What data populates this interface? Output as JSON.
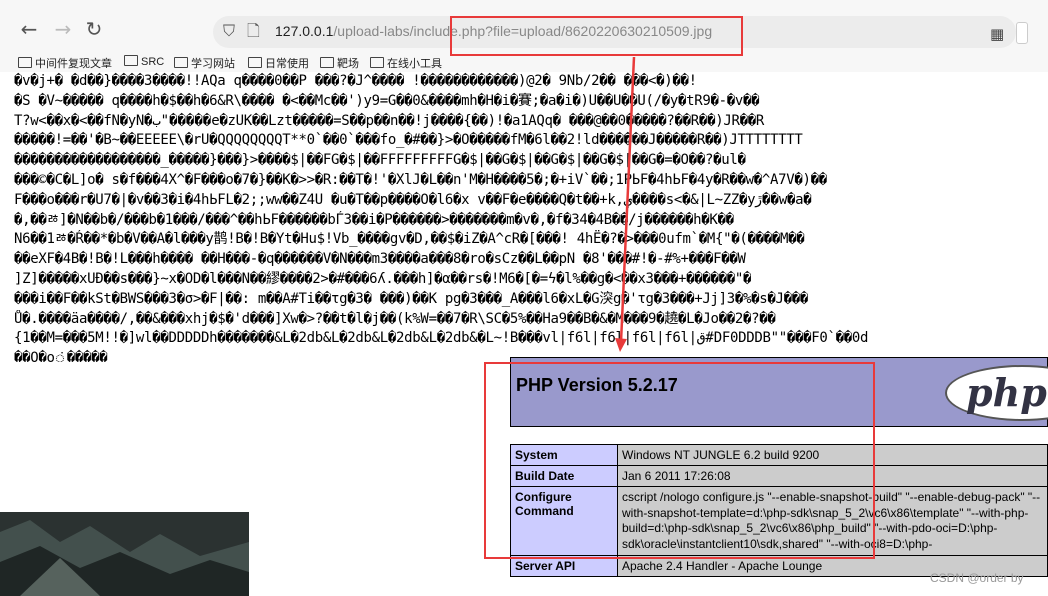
{
  "toolbar": {
    "back_icon": "back-arrow-icon",
    "forward_icon": "forward-arrow-icon",
    "reload_icon": "reload-icon",
    "url_host": "127.0.0.1",
    "url_path": "/upload-labs/include.php?file=upload/8620220630210509.jpg"
  },
  "bookmarks": [
    "中间件复现文章",
    "SRC",
    "学习网站",
    "日常使用",
    "靶场",
    "在线小工具"
  ],
  "garbage_lines": [
    "�v�j+� �d��}����3����!!AQa q����0��P ���?�J^���� !������������)@2� 9Nb/2�� ���<�)��!",
    "�S �V~����� q����h�$��h�6&R\\���� �<��Mc��')y9=G��0&����mh�H�i�賽;�a�i�)U��U��U(/�y�tR9�-�v��",
    "T?w<��x�<��fN�yN�ب\"�����e�zUK��Lzt�����=S��p��n��!j����{��)!�a1AQq� ���@��0�����?��R��)JR��R",
    "�����!=��'�B~��EEEEE\\�rU�QQQQQQQQT**0`��0`���fo_�#��}>�O�����fM�6l��2!ld������J�����R��)JTTTTTTTT",
    "������������������_�����}���}>����$|��FG�$|��FFFFFFFFFG�$|��G�$|��G�$|��G�$|��G�=�O��?�ul�",
    "���©�C�L]o� s�f���4X^�F���o�7�}��K�>>�R:��T�!'�XlJ�L��n'M�H����5�;�+iV`��;1PЬF�4hЬF�4y�R��w�^A7V�)��",
    "F���o���r�U7�|�v��3�i�4hЬFL�2;;ww��Z4U �u�T��p����O�l6�x v��F�e����Q�t��+k,ي����s<�&|L~ZZ�yڙ��w�a�",
    "�,��ﾰ]�N��b�/���b�1���/���^��hЬF������bЃ3��i�P������>�������m�v�,�f�34�4B��/j������h�K��",
    "N6��1ﾰ�Ŕ��*�b�V��A�l���y鹊!B�!B�Yt�Hu$!Vb_����gv�D,��$�iZ�A^cR�[���! 4hË�?�>���0ufm`�M{\"�(����M��",
    "��eXF�4B�!B�!L���h���� ��H���-�q������V�N���m3����a���8�ro�sCz��L��pN �8'���#!�-#%+���F��W",
    "]Z]�����xUĐ��s���}~x�OD�l���N��繆����2>�#���6ʎ.���h]�α��rs�!M6�[�=ϟ�l%��g�<��x3���+������\"�",
    "���i��F��kSt�BWS���3�σ>�F|��: m��A#Ti��τg�3� ���)��K pg�3���_A���l6�xL�G湥g�'τg�3���+Jj]3�%�s�J���",
    "Ů�.����äa����/,��&���xhj�$�'d���]Xw�>?��t�l�j��(k%W=��7�R\\SC�5%��Ha9��B�&�M���9�趬�L�Jo��2�?��",
    "{1��M=���5M!!�]wl��DDDDDh�������&L�2db&L�2db&L�2db&L�2db&�L~!B���vl|f6l|f6l|f6l|f6l|ق#DF0DDDB\"\"���F0`��0d",
    "��O�o்�����"
  ],
  "phpinfo": {
    "title": "PHP Version 5.2.17",
    "logo_text": "php",
    "rows": [
      {
        "label": "System",
        "value": "Windows NT JUNGLE 6.2 build 9200"
      },
      {
        "label": "Build Date",
        "value": "Jan 6 2011 17:26:08"
      },
      {
        "label": "Configure Command",
        "value": "cscript /nologo configure.js \"--enable-snapshot-build\" \"--enable-debug-pack\" \"--with-snapshot-template=d:\\php-sdk\\snap_5_2\\vc6\\x86\\template\" \"--with-php-build=d:\\php-sdk\\snap_5_2\\vc6\\x86\\php_build\" \"--with-pdo-oci=D:\\php-sdk\\oracle\\instantclient10\\sdk,shared\" \"--with-oci8=D:\\php-sdk\\oracle\\instantclient10\\sdk,shared\" \"--without-pi3web\""
      },
      {
        "label": "Server API",
        "value": "Apache 2.4 Handler - Apache Lounge"
      }
    ]
  },
  "watermark": "CSDN @order by",
  "colors": {
    "annotation": "#e83a3a",
    "php_header": "#9999cc",
    "php_label_bg": "#ccccff",
    "php_value_bg": "#cccccc"
  }
}
